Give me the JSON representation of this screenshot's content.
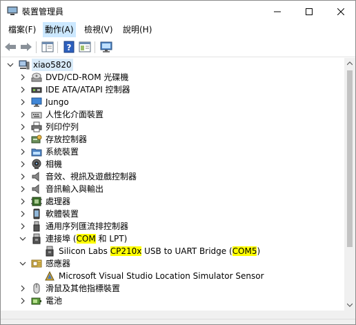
{
  "window": {
    "title": "裝置管理員",
    "controls": {
      "minimize": "minimize",
      "maximize": "maximize",
      "close": "close"
    }
  },
  "menu": [
    "檔案(F)",
    "動作(A)",
    "檢視(V)",
    "說明(H)"
  ],
  "toolbar": {
    "icons": [
      "back-arrow-icon",
      "forward-arrow-icon",
      "properties-pane-icon",
      "help-icon",
      "show-hide-icon",
      "monitor-icon"
    ]
  },
  "tree": {
    "root": {
      "label": "xiao5820",
      "expanded": true
    },
    "categories": [
      {
        "label": "DVD/CD-ROM 光碟機",
        "icon": "optical-drive-icon",
        "expanded": false
      },
      {
        "label": "IDE ATA/ATAPI 控制器",
        "icon": "ide-controller-icon",
        "expanded": false
      },
      {
        "label": "Jungo",
        "icon": "monitor-device-icon",
        "expanded": false
      },
      {
        "label": "人性化介面裝置",
        "icon": "keyboard-icon",
        "expanded": false
      },
      {
        "label": "列印佇列",
        "icon": "printer-icon",
        "expanded": false
      },
      {
        "label": "存放控制器",
        "icon": "storage-controller-icon",
        "expanded": false
      },
      {
        "label": "系統裝置",
        "icon": "system-folder-icon",
        "expanded": false
      },
      {
        "label": "相機",
        "icon": "camera-icon",
        "expanded": false
      },
      {
        "label": "音效、視訊及遊戲控制器",
        "icon": "speaker-icon",
        "expanded": false
      },
      {
        "label": "音訊輸入與輸出",
        "icon": "speaker-icon",
        "expanded": false
      },
      {
        "label": "處理器",
        "icon": "processor-icon",
        "expanded": false
      },
      {
        "label": "軟體裝置",
        "icon": "software-device-icon",
        "expanded": false
      },
      {
        "label": "通用序列匯流排控制器",
        "icon": "usb-icon",
        "expanded": false
      },
      {
        "label": "連接埠 (COM 和 LPT)",
        "icon": "port-icon",
        "expanded": true,
        "label_parts": {
          "pre": "連接埠 (",
          "hl": "COM",
          "post": " 和 LPT)"
        }
      },
      {
        "label": "Silicon Labs CP210x USB to UART Bridge (COM5)",
        "icon": "port-icon",
        "child": true,
        "label_parts": {
          "a": "Silicon Labs ",
          "hl1": "CP210x",
          "b": " USB to UART Bridge (",
          "hl2": "COM5",
          "c": ")"
        }
      },
      {
        "label": "感應器",
        "icon": "sensor-icon",
        "expanded": true
      },
      {
        "label": "Microsoft Visual Studio Location Simulator Sensor",
        "icon": "location-sensor-icon",
        "child": true
      },
      {
        "label": "滑鼠及其他指標裝置",
        "icon": "mouse-icon",
        "expanded": false
      },
      {
        "label": "電池",
        "icon": "battery-icon",
        "expanded": false
      }
    ]
  },
  "colors": {
    "highlight": "#ffff00",
    "selection": "#d9ebf9",
    "menu_active": "#cce8ff"
  }
}
